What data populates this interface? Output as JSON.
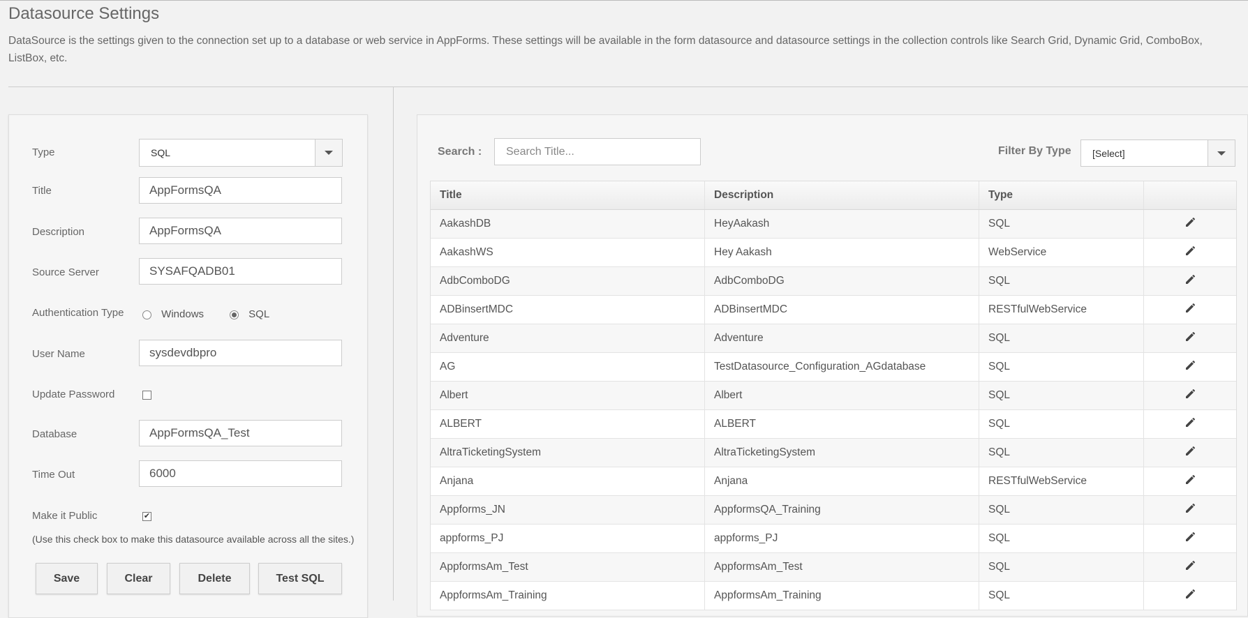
{
  "header": {
    "title": "Datasource Settings",
    "description": "DataSource is the settings given to the connection set up to a database or web service in AppForms. These settings will be available in the form datasource and datasource settings in the collection controls like Search Grid, Dynamic Grid, ComboBox, ListBox, etc."
  },
  "form": {
    "type_label": "Type",
    "type_value": "SQL",
    "title_label": "Title",
    "title_value": "AppFormsQA",
    "description_label": "Description",
    "description_value": "AppFormsQA",
    "source_server_label": "Source Server",
    "source_server_value": "SYSAFQADB01",
    "auth_type_label": "Authentication Type",
    "auth_options": [
      "Windows",
      "SQL"
    ],
    "auth_selected": "SQL",
    "user_name_label": "User Name",
    "user_name_value": "sysdevdbpro",
    "update_password_label": "Update Password",
    "update_password_checked": false,
    "database_label": "Database",
    "database_value": "AppFormsQA_Test",
    "timeout_label": "Time Out",
    "timeout_value": "6000",
    "make_public_label": "Make it Public",
    "make_public_checked": true,
    "make_public_note": "(Use this check box to make this datasource available across all the sites.)",
    "buttons": {
      "save": "Save",
      "clear": "Clear",
      "delete": "Delete",
      "test": "Test SQL"
    }
  },
  "list": {
    "search_label": "Search :",
    "search_placeholder": "Search Title...",
    "filter_label": "Filter By Type",
    "filter_value": "[Select]",
    "columns": [
      "Title",
      "Description",
      "Type",
      ""
    ],
    "rows": [
      {
        "title": "AakashDB",
        "description": "HeyAakash",
        "type": "SQL"
      },
      {
        "title": "AakashWS",
        "description": "Hey Aakash",
        "type": "WebService"
      },
      {
        "title": "AdbComboDG",
        "description": "AdbComboDG",
        "type": "SQL"
      },
      {
        "title": "ADBinsertMDC",
        "description": "ADBinsertMDC",
        "type": "RESTfulWebService"
      },
      {
        "title": "Adventure",
        "description": "Adventure",
        "type": "SQL"
      },
      {
        "title": "AG",
        "description": "TestDatasource_Configuration_AGdatabase",
        "type": "SQL"
      },
      {
        "title": "Albert",
        "description": "Albert",
        "type": "SQL"
      },
      {
        "title": "ALBERT",
        "description": "ALBERT",
        "type": "SQL"
      },
      {
        "title": "AltraTicketingSystem",
        "description": "AltraTicketingSystem",
        "type": "SQL"
      },
      {
        "title": "Anjana",
        "description": "Anjana",
        "type": "RESTfulWebService"
      },
      {
        "title": "Appforms_JN",
        "description": "AppformsQA_Training",
        "type": "SQL"
      },
      {
        "title": "appforms_PJ",
        "description": "appforms_PJ",
        "type": "SQL"
      },
      {
        "title": "AppformsAm_Test",
        "description": "AppformsAm_Test",
        "type": "SQL"
      },
      {
        "title": "AppformsAm_Training",
        "description": "AppformsAm_Training",
        "type": "SQL"
      }
    ]
  }
}
